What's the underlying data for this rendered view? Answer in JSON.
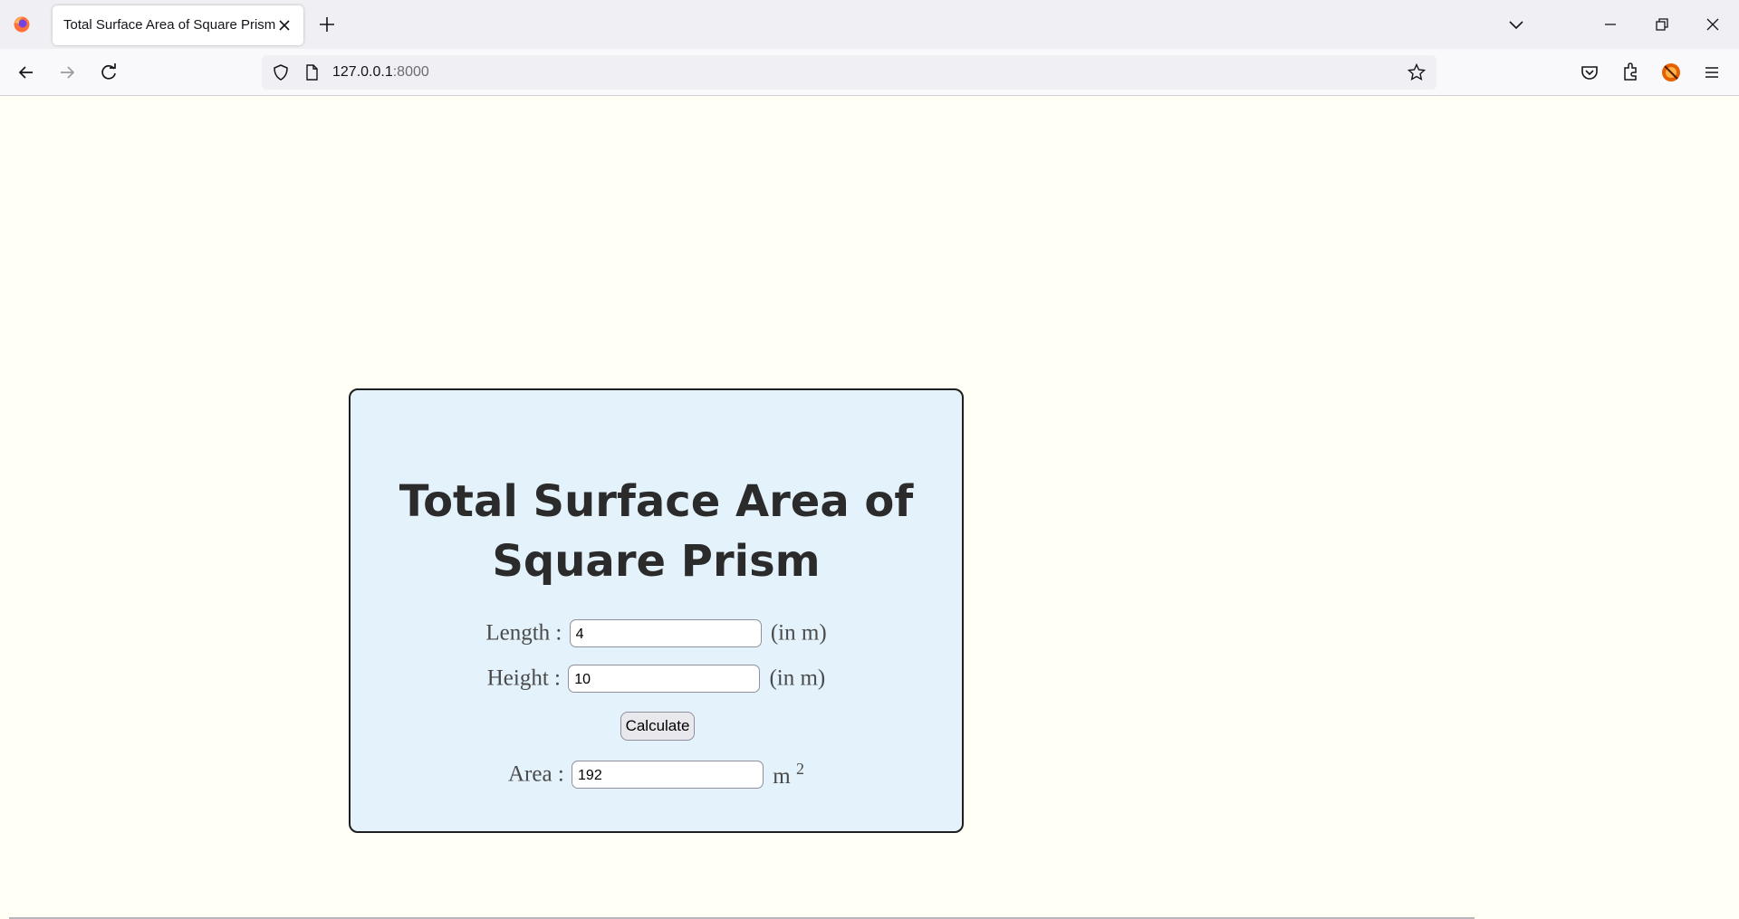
{
  "browser": {
    "tab_title": "Total Surface Area of Square Prism",
    "url_host": "127.0.0.1",
    "url_port": ":8000"
  },
  "page": {
    "heading_line1": "Total Surface Area of",
    "heading_line2": "Square Prism",
    "length_label": "Length :",
    "length_value": "4",
    "length_unit": "(in m)",
    "height_label": "Height :",
    "height_value": "10",
    "height_unit": "(in m)",
    "calculate_label": "Calculate",
    "area_label": "Area :",
    "area_value": "192",
    "area_unit": "m",
    "area_exponent": "2"
  },
  "colors": {
    "page_background": "#fffff5",
    "card_background": "#e3f2fb",
    "card_border": "#1f1f1f"
  },
  "icons": [
    "firefox-logo-icon",
    "close-icon",
    "plus-icon",
    "chevron-down-icon",
    "minimize-icon",
    "restore-icon",
    "close-window-icon",
    "back-arrow-icon",
    "forward-arrow-icon",
    "reload-icon",
    "shield-icon",
    "page-icon",
    "star-icon",
    "pocket-icon",
    "extensions-icon",
    "profile-icon",
    "menu-icon"
  ]
}
